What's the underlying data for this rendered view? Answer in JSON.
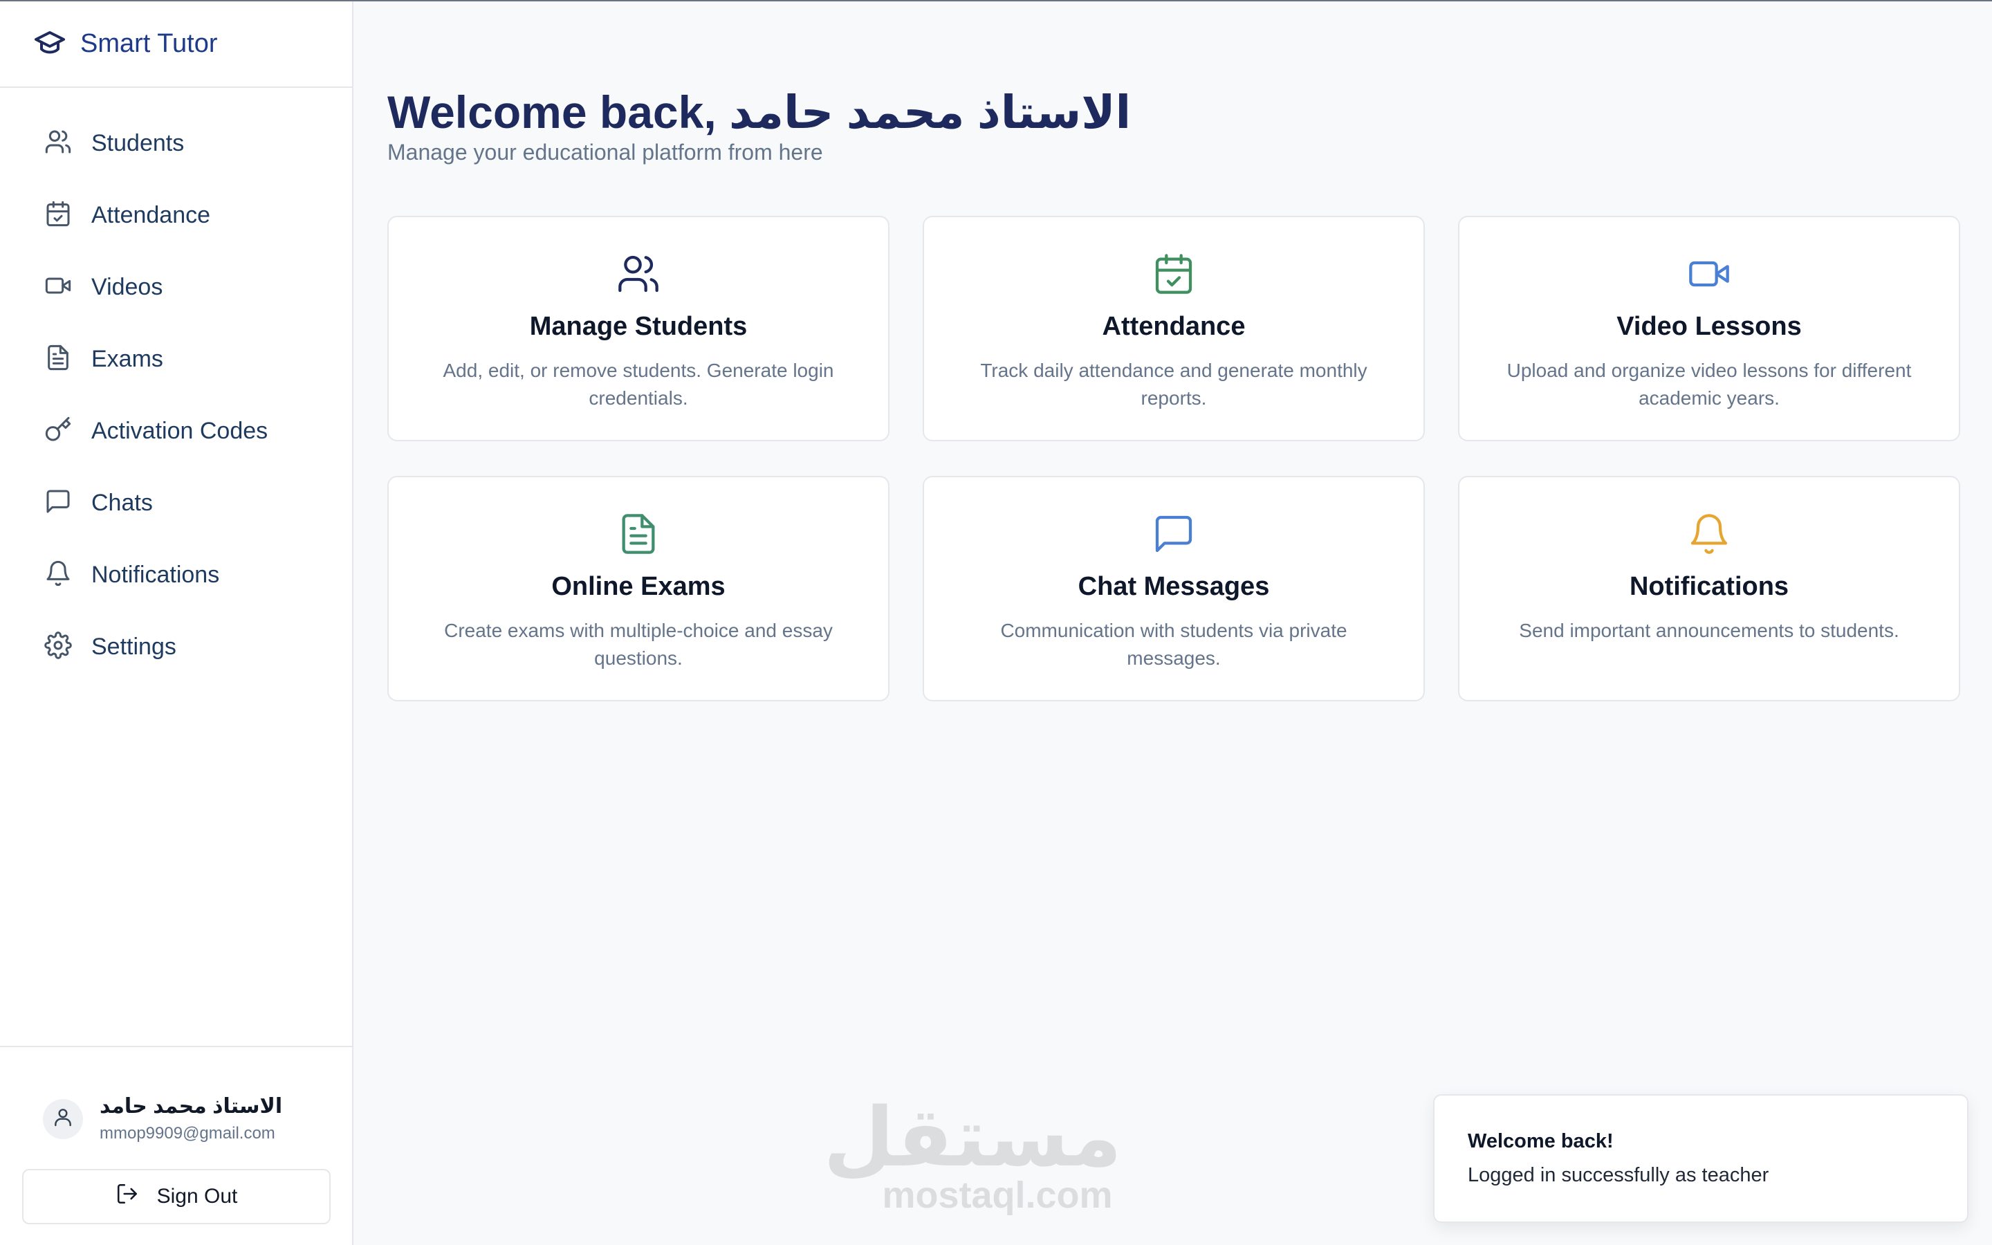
{
  "brand": {
    "name": "Smart Tutor",
    "icon": "graduation-cap-icon"
  },
  "sidebar": {
    "items": [
      {
        "label": "Students",
        "icon": "users-icon"
      },
      {
        "label": "Attendance",
        "icon": "calendar-check-icon"
      },
      {
        "label": "Videos",
        "icon": "video-icon"
      },
      {
        "label": "Exams",
        "icon": "file-text-icon"
      },
      {
        "label": "Activation Codes",
        "icon": "key-icon"
      },
      {
        "label": "Chats",
        "icon": "message-square-icon"
      },
      {
        "label": "Notifications",
        "icon": "bell-icon"
      },
      {
        "label": "Settings",
        "icon": "gear-icon"
      }
    ],
    "user": {
      "name": "الاستاذ محمد حامد",
      "email": "mmop9909@gmail.com"
    },
    "signout_label": "Sign Out"
  },
  "main": {
    "title": "Welcome back, الاستاذ محمد حامد",
    "subtitle": "Manage your educational platform from here",
    "cards": [
      {
        "title": "Manage Students",
        "desc": "Add, edit, or remove students. Generate login credentials.",
        "icon": "users-icon",
        "color": "#1e2a5e"
      },
      {
        "title": "Attendance",
        "desc": "Track daily attendance and generate monthly reports.",
        "icon": "calendar-check-icon",
        "color": "#3f8f5f"
      },
      {
        "title": "Video Lessons",
        "desc": "Upload and organize video lessons for different academic years.",
        "icon": "video-icon",
        "color": "#4a7fd4"
      },
      {
        "title": "Online Exams",
        "desc": "Create exams with multiple-choice and essay questions.",
        "icon": "file-text-icon",
        "color": "#3f8f6f"
      },
      {
        "title": "Chat Messages",
        "desc": "Communication with students via private messages.",
        "icon": "message-square-icon",
        "color": "#4a7fd4"
      },
      {
        "title": "Notifications",
        "desc": "Send important announcements to students.",
        "icon": "bell-icon",
        "color": "#e5a52e"
      }
    ]
  },
  "watermark": {
    "arabic": "مستقل",
    "latin": "mostaql.com"
  },
  "toast": {
    "title": "Welcome back!",
    "message": "Logged in successfully as teacher"
  }
}
